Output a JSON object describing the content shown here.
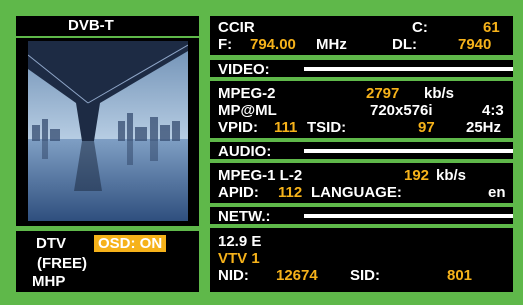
{
  "left": {
    "header": "DVB-T",
    "dtv_label": "DTV",
    "osd_label": "OSD: ON",
    "free_label": "(FREE)",
    "mhp_label": "MHP"
  },
  "tuning": {
    "standard": "CCIR",
    "channel_label": "C:",
    "channel_value": "61",
    "freq_label": "F:",
    "freq_value": "794.00",
    "freq_unit": "MHz",
    "dl_label": "DL:",
    "dl_value": "7940"
  },
  "video": {
    "section_label": "VIDEO:",
    "codec": "MPEG-2",
    "bitrate": "2797",
    "bitrate_unit": "kb/s",
    "profile": "MP@ML",
    "resolution": "720x576i",
    "aspect": "4:3",
    "vpid_label": "VPID:",
    "vpid_value": "111",
    "tsid_label": "TSID:",
    "tsid_value": "97",
    "framerate": "25Hz"
  },
  "audio": {
    "section_label": "AUDIO:",
    "codec": "MPEG-1 L-2",
    "bitrate": "192",
    "bitrate_unit": "kb/s",
    "apid_label": "APID:",
    "apid_value": "112",
    "language_label": "LANGUAGE:",
    "language_value": "en"
  },
  "network": {
    "section_label": "NETW.:",
    "position": "12.9 E",
    "provider": "VTV 1",
    "nid_label": "NID:",
    "nid_value": "12674",
    "sid_label": "SID:",
    "sid_value": "801"
  },
  "colors": {
    "background": "#5fb84a",
    "panel": "#000000",
    "value": "#f6b21a",
    "text": "#ffffff"
  }
}
